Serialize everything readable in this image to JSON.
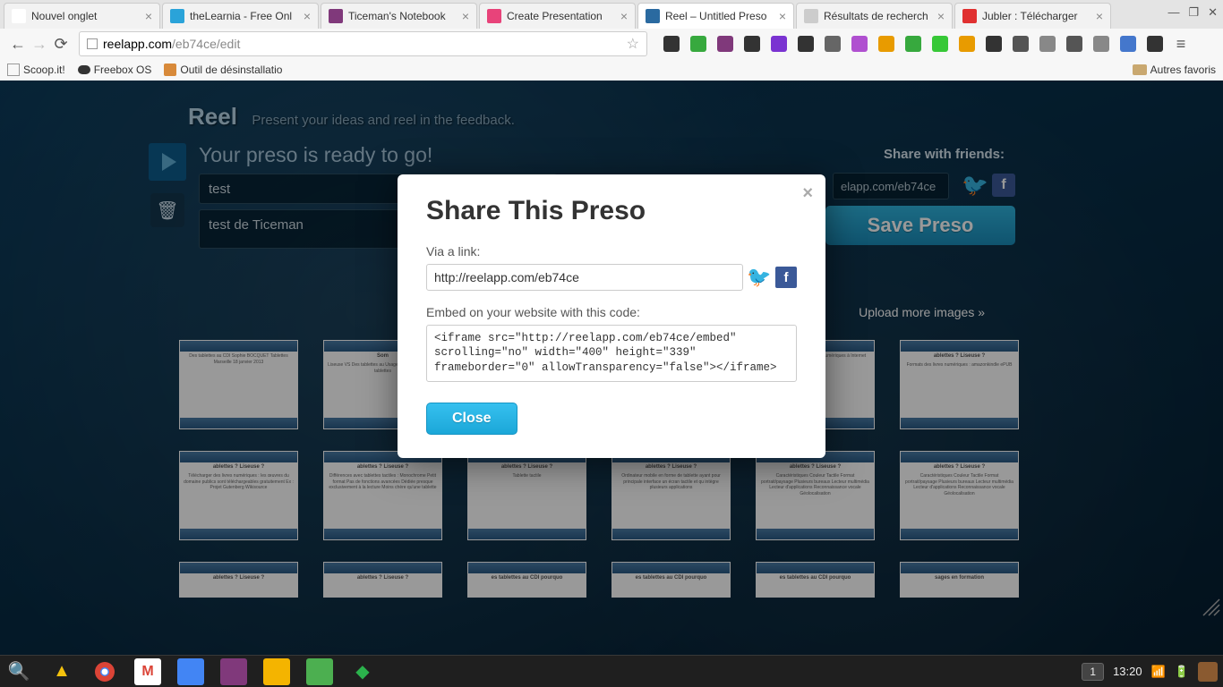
{
  "browser": {
    "tabs": [
      {
        "title": "Nouvel onglet",
        "color": "#ffffff"
      },
      {
        "title": "theLearnia - Free Onl",
        "color": "#2aa3d9"
      },
      {
        "title": "Ticeman's Notebook",
        "color": "#80397b"
      },
      {
        "title": "Create Presentation",
        "color": "#e8437a"
      },
      {
        "title": "Reel – Untitled Preso",
        "color": "#2a6aa0",
        "active": true
      },
      {
        "title": "Résultats de recherch",
        "color": "#cccccc"
      },
      {
        "title": "Jubler : Télécharger",
        "color": "#e03030"
      }
    ],
    "url_domain": "reelapp.com",
    "url_path": "/eb74ce/edit",
    "bookmarks": {
      "scoopit": "Scoop.it!",
      "freebox": "Freebox OS",
      "uninstall": "Outil de désinstallatio",
      "other": "Autres favoris"
    }
  },
  "page": {
    "brand": "Reel",
    "tagline": "Present your ideas and reel in the feedback.",
    "ready": "Your preso is ready to go!",
    "share_friends": "Share with friends:",
    "title_value": "test",
    "desc_value": "test de Ticeman",
    "share_url_value": "elapp.com/eb74ce",
    "save_btn": "Save Preso",
    "upload_link": "Upload more images »",
    "thumbs_row1": [
      {
        "title": "",
        "body": "Des tablettes au CDI\nSophie BOCQUET\nTablettes Marseille\n18 janvier 2013"
      },
      {
        "title": "Som",
        "body": "Liseuse VS\nDes tablettes au\nUsages en\nUsages en\nLes tablettes"
      },
      {
        "title": "",
        "body": ""
      },
      {
        "title": "",
        "body": ""
      },
      {
        "title": "",
        "body": "tistiques\nde lire et de stocker\nnumériques\nà Internet"
      },
      {
        "title": "ablettes ? Liseuse ?",
        "body": "Formats des livres numériques :\namazonkindle\nePUB"
      }
    ],
    "thumbs_row2": [
      {
        "title": "ablettes ? Liseuse ?",
        "body": "Télécharger des livres numériques :\nles œuvres du domaine publics sont téléchargeables\ngratuitement\nEx : Projet Gutenberg\nWikisource"
      },
      {
        "title": "ablettes ? Liseuse ?",
        "body": "Différences avec tablettes tactiles :\nMonochrome\nPetit format\nPas de fonctions avancées\nDédiée presque exclusivement à la lecture\nMoins chère qu'une tablette"
      },
      {
        "title": "ablettes ? Liseuse ?",
        "body": "Tablette tactile"
      },
      {
        "title": "ablettes ? Liseuse ?",
        "body": "Ordinateur mobile en forme de tablette\nayant pour\nprincipale interface un écran tactile et qu\nintègre plusieurs applications"
      },
      {
        "title": "ablettes ? Liseuse ?",
        "body": "Caractéristiques\nCouleur\nTactile\nFormat portrait/paysage\nPlusieurs bureaux\nLecteur multimédia\nLecteur d'applications\nReconnaissance vocale\nGéolocalisation"
      },
      {
        "title": "ablettes ? Liseuse ?",
        "body": "Caractéristiques\nCouleur\nTactile\nFormat portrait/paysage\nPlusieurs bureaux\nLecteur multimédia\nLecteur d'applications\nReconnaissance vocale\nGéolocalisation"
      }
    ],
    "thumbs_row3": [
      {
        "title": "ablettes ? Liseuse ?"
      },
      {
        "title": "ablettes ? Liseuse ?"
      },
      {
        "title": "es tablettes au CDI pourquo"
      },
      {
        "title": "es tablettes au CDI pourquo"
      },
      {
        "title": "es tablettes au CDI pourquo"
      },
      {
        "title": "sages en formation"
      }
    ]
  },
  "modal": {
    "title": "Share This Preso",
    "via_link_label": "Via a link:",
    "link_value": "http://reelapp.com/eb74ce",
    "embed_label": "Embed on your website with this code:",
    "embed_value": "<iframe src=\"http://reelapp.com/eb74ce/embed\" scrolling=\"no\" width=\"400\" height=\"339\" frameborder=\"0\" allowTransparency=\"false\"></iframe>",
    "close_btn": "Close"
  },
  "taskbar": {
    "workspace": "1",
    "time": "13:20"
  },
  "ext_colors": [
    "#333",
    "#37a93e",
    "#80397b",
    "#333",
    "#7a33d1",
    "#333",
    "#666",
    "#b050d0",
    "#e89b00",
    "#37a93e",
    "#37c837",
    "#e89b00",
    "#333",
    "#555",
    "#888",
    "#555",
    "#888",
    "#4477cc",
    "#333"
  ]
}
